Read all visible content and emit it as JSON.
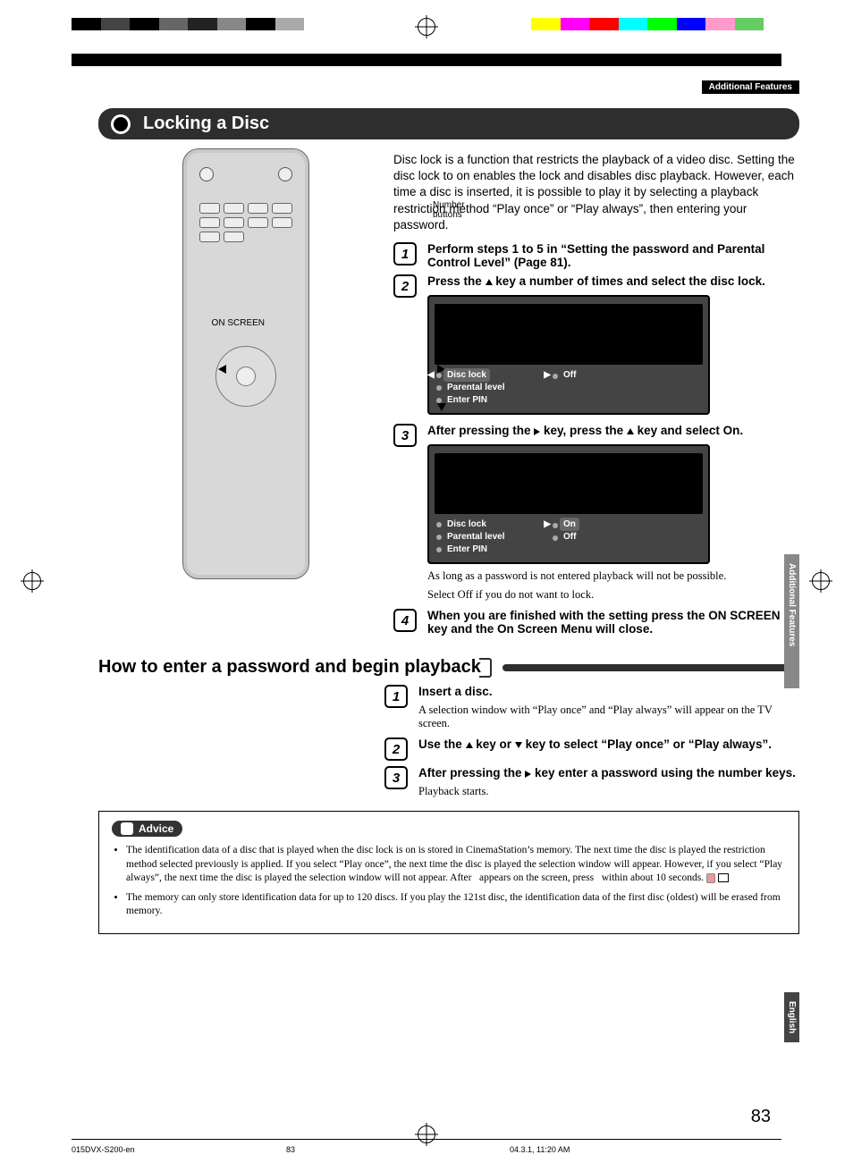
{
  "header": {
    "tag": "Additional Features"
  },
  "section_title": "Locking a Disc",
  "intro": "Disc lock is a function that restricts the playback of a video disc. Setting the disc lock to on enables the lock and disables disc playback. However, each time a disc is inserted, it is possible to play it by selecting a playback restriction method “Play once” or “Play always”, then entering your password.",
  "remote_labels": {
    "numbers": "Number buttons",
    "on_screen": "ON SCREEN"
  },
  "steps_a": [
    {
      "n": "1",
      "body_bold": "Perform steps 1 to 5 in “Setting the password and Parental Control Level” (Page 81)."
    },
    {
      "n": "2",
      "body_bold_pre": "Press the ",
      "body_bold_post": " key a number of times and select the disc lock."
    },
    {
      "n": "3",
      "body_bold_pre": "After pressing the ",
      "body_bold_mid": " key, press the ",
      "body_bold_post": " key and select On."
    },
    {
      "n": "4",
      "body_bold": "When you are finished with the setting press the ON SCREEN key and the On Screen Menu will close."
    }
  ],
  "osd1": {
    "rows": [
      {
        "label": "Disc lock",
        "value": "Off",
        "hl_left": true
      },
      {
        "label": "Parental level",
        "value": ""
      },
      {
        "label": "Enter PIN",
        "value": ""
      }
    ]
  },
  "osd2": {
    "rows": [
      {
        "label": "Disc lock",
        "value": "On",
        "hl_right_first": true
      },
      {
        "label": "Parental level",
        "value": "Off"
      },
      {
        "label": "Enter PIN",
        "value": ""
      }
    ]
  },
  "note_a1": "As long as a password is not entered playback will not be possible.",
  "note_a2": "Select Off if you do not want to lock.",
  "sub_heading": "How to enter a password and begin playback",
  "steps_b": [
    {
      "n": "1",
      "bold": "Insert a disc.",
      "body": "A selection window with “Play once” and “Play always” will appear on the TV screen."
    },
    {
      "n": "2",
      "bold_pre": "Use the ",
      "bold_mid": " key or ",
      "bold_post": " key to select “Play once” or “Play always”."
    },
    {
      "n": "3",
      "bold_pre": "After pressing the ",
      "bold_post": " key enter a password using the number keys.",
      "body": "Playback starts."
    }
  ],
  "advice": {
    "label": "Advice",
    "items": [
      "The identification data of a disc that is played when the disc lock is on is stored in CinemaStation’s memory. The next time the disc is played the restriction method selected previously is applied. If you select “Play once”, the next time the disc is played the selection window will appear. However, if you select “Play always”, the next time the disc is played the selection window will not appear. After   appears on the screen, press   within about 10 seconds.",
      "The memory can only store identification data for up to 120 discs. If you play the 121st disc, the identification data of the first disc (oldest) will be erased from memory."
    ]
  },
  "side": {
    "features": "Additional Features",
    "english": "English"
  },
  "page_number": "83",
  "footer": {
    "left": "015DVX-S200-en",
    "center": "83",
    "right": "04.3.1, 11:20 AM"
  }
}
